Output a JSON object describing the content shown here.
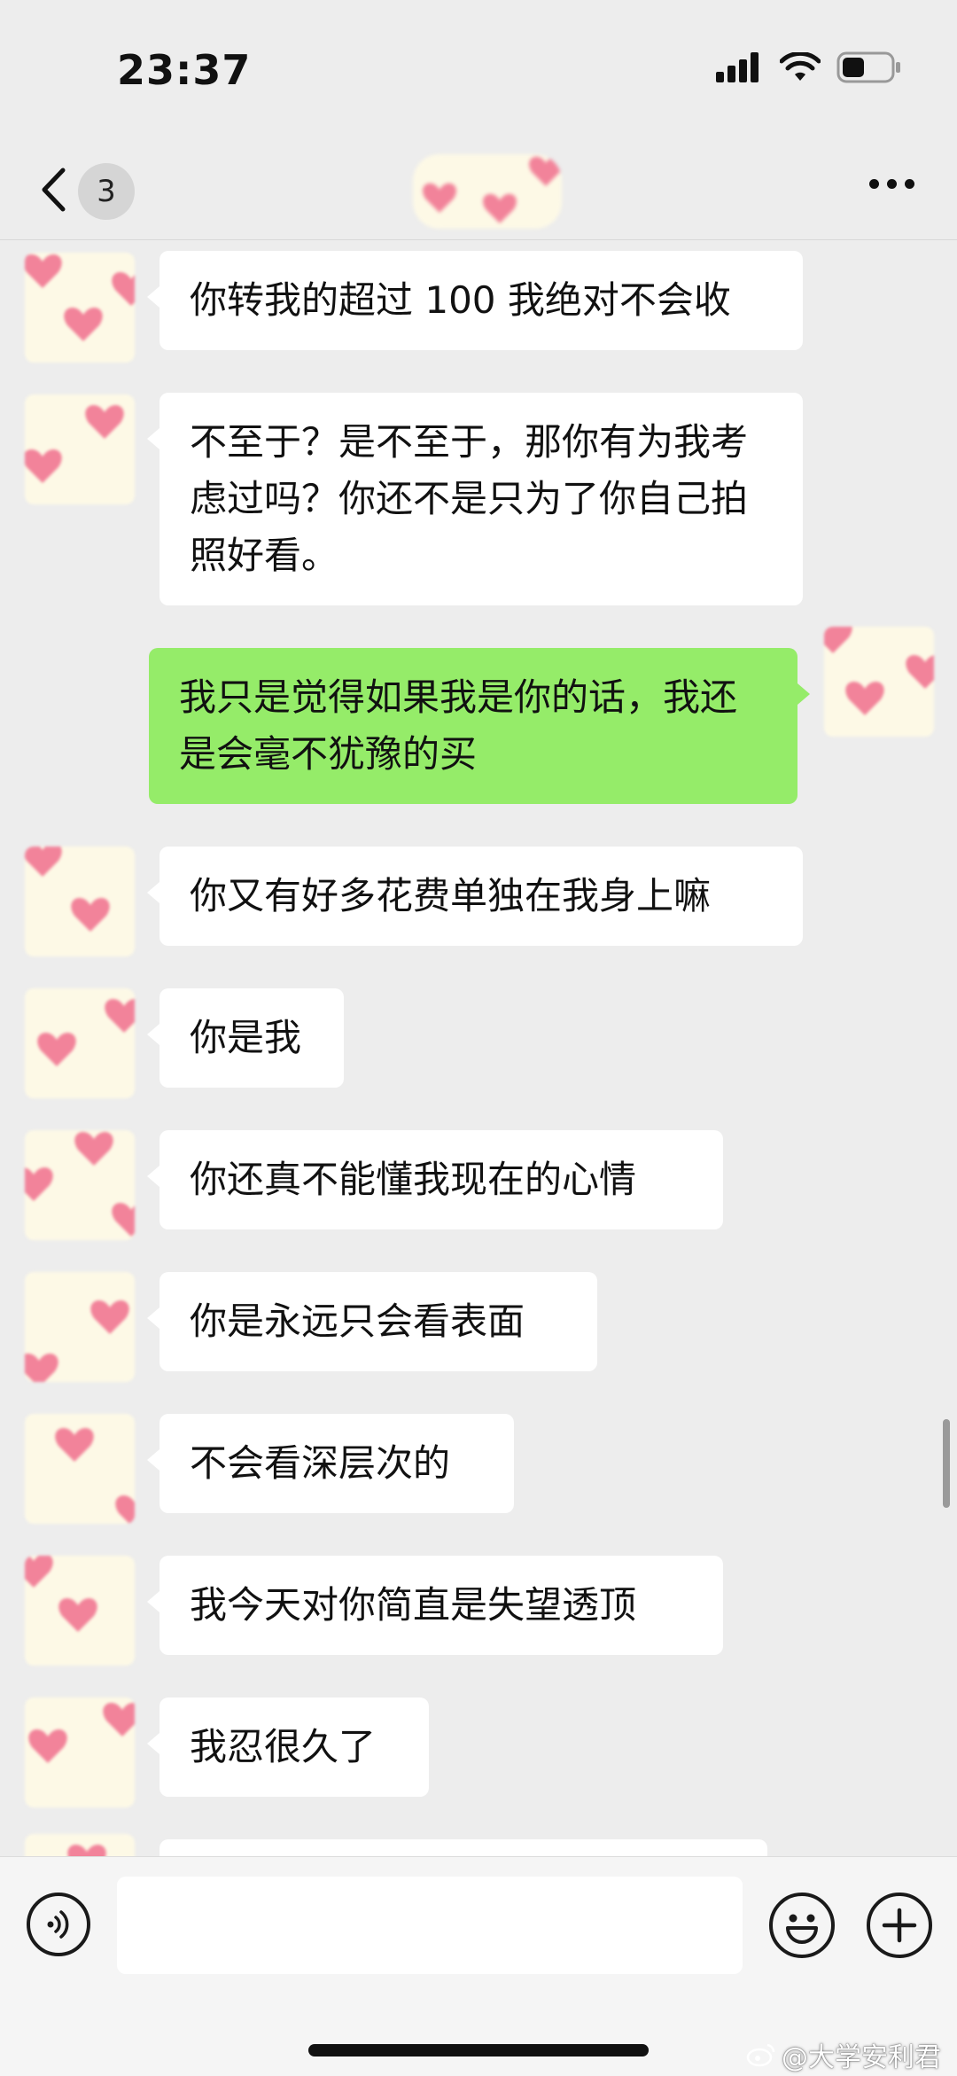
{
  "status_bar": {
    "time": "23:37"
  },
  "nav": {
    "unread_count": "3"
  },
  "colors": {
    "incoming_bubble": "#ffffff",
    "outgoing_bubble": "#95ec69",
    "background": "#ededed"
  },
  "messages": [
    {
      "dir": "in",
      "text": "你转我的超过 100 我绝对不会收"
    },
    {
      "dir": "in",
      "text": "不至于？是不至于，那你有为我考虑过吗？你还不是只为了你自己拍照好看。"
    },
    {
      "dir": "out",
      "text": "我只是觉得如果我是你的话，我还是会毫不犹豫的买"
    },
    {
      "dir": "in",
      "text": "你又有好多花费单独在我身上嘛"
    },
    {
      "dir": "in",
      "text": "你是我"
    },
    {
      "dir": "in",
      "text": "你还真不能懂我现在的心情"
    },
    {
      "dir": "in",
      "text": "你是永远只会看表面"
    },
    {
      "dir": "in",
      "text": "不会看深层次的"
    },
    {
      "dir": "in",
      "text": "我今天对你简直是失望透顶"
    },
    {
      "dir": "in",
      "text": "我忍很久了"
    }
  ],
  "input": {
    "value": ""
  },
  "icons": {
    "back": "chevron-left-icon",
    "more": "more-dots-icon",
    "voice": "voice-icon",
    "emoji": "emoji-icon",
    "plus": "plus-icon",
    "signal": "signal-icon",
    "wifi": "wifi-icon",
    "battery": "battery-icon"
  },
  "watermark": {
    "text": "@大学安利君"
  }
}
